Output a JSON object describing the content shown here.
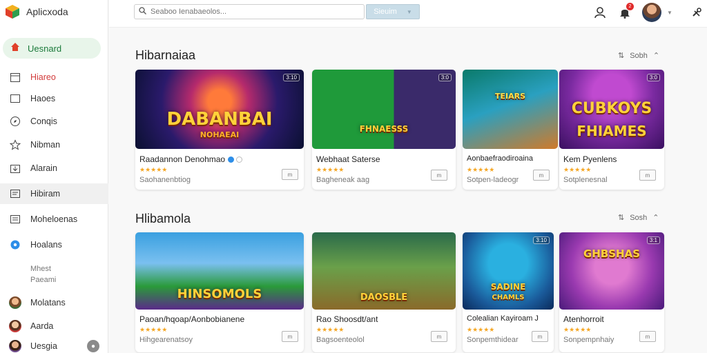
{
  "app": {
    "title": "Aplicxoda"
  },
  "sidebar": {
    "active": {
      "label": "Uesnard"
    },
    "items": [
      {
        "label": "Hiareo"
      },
      {
        "label": "Haoes"
      },
      {
        "label": "Conqis"
      },
      {
        "label": "Nibman"
      },
      {
        "label": "Alarain"
      },
      {
        "label": "Hibiram"
      },
      {
        "label": "Moheloenas"
      },
      {
        "label": "Hoalans"
      }
    ],
    "sub_label_1": "Mhest",
    "sub_label_2": "Paeami",
    "users": [
      {
        "label": "Molatans"
      },
      {
        "label": "Aarda"
      },
      {
        "label": "Uesgia"
      }
    ]
  },
  "header": {
    "search_placeholder": "Seaboo Ienabaeolos...",
    "search_button": "Sieuim",
    "notification_count": "2"
  },
  "sections": [
    {
      "title": "Hibarnaiaa",
      "more": "Sobh",
      "cards": [
        {
          "thumb_title": "DABANBAI",
          "thumb_sub": "NOHAEAI",
          "age": "3:10",
          "name": "Raadannon Denohmao",
          "rating": "★★★★★",
          "subtitle": "Saohanenbtiog",
          "button": "m"
        },
        {
          "thumb_title": "FHNAESSS",
          "thumb_sub": "",
          "age": "3:0",
          "name": "Webhaat Saterse",
          "rating": "★★★★★",
          "subtitle": "Bagheneak aag",
          "button": "m"
        },
        {
          "thumb_title": "TEIARS",
          "thumb_sub": "",
          "age": "",
          "name": "Aonbaefraodiroaina",
          "rating": "★★★★★",
          "subtitle": "Sotpen-ladeogr",
          "button": "m"
        },
        {
          "thumb_title": "CUBKOYS",
          "thumb_sub": "FHIAMES",
          "age": "3:0",
          "name": "Kem Pyenlens",
          "rating": "★★★★★",
          "subtitle": "Sotplenesnal",
          "button": "m"
        }
      ]
    },
    {
      "title": "Hlibamola",
      "more": "Sosh",
      "cards": [
        {
          "thumb_title": "HINSOMOLS",
          "thumb_sub": "",
          "age": "",
          "name": "Paoan/hqoap/Aonbobianene",
          "rating": "★★★★★",
          "subtitle": "Hihgearenatsoy",
          "button": "m"
        },
        {
          "thumb_title": "DAOSBLE",
          "thumb_sub": "",
          "age": "",
          "name": "Rao Shoosdt/ant",
          "rating": "★★★★★",
          "subtitle": "Bagsoenteolol",
          "button": "m"
        },
        {
          "thumb_title": "SADINE",
          "thumb_sub": "CHAMLS",
          "age": "3:10",
          "name": "Colealian Kayiroam J",
          "rating": "★★★★★",
          "subtitle": "Sonpemthidear",
          "button": "m"
        },
        {
          "thumb_title": "GHBSHAS",
          "thumb_sub": "",
          "age": "3:1",
          "name": "Atenhorroit",
          "rating": "★★★★★",
          "subtitle": "Sonpempnhaiy",
          "button": "m"
        }
      ]
    }
  ],
  "colors": {
    "accent_green": "#1a7a3a",
    "star": "#f5a623",
    "red": "#d23b3b"
  }
}
